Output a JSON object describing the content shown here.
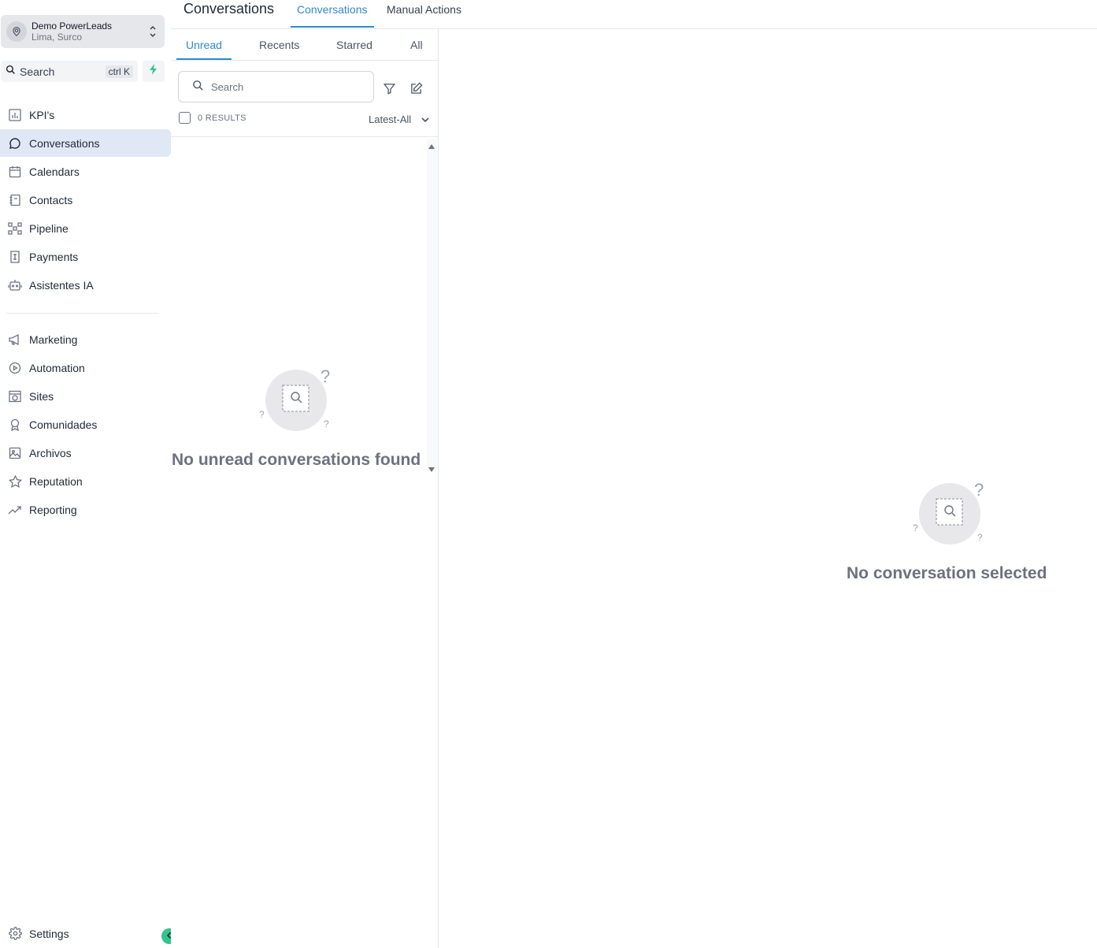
{
  "account": {
    "name": "Demo PowerLeads",
    "location": "Lima, Surco"
  },
  "search": {
    "label": "Search",
    "shortcut": "ctrl K"
  },
  "nav": {
    "primary": [
      {
        "label": "KPI's",
        "icon": "bar-chart-icon"
      },
      {
        "label": "Conversations",
        "icon": "chat-bubble-icon",
        "active": true
      },
      {
        "label": "Calendars",
        "icon": "calendar-icon"
      },
      {
        "label": "Contacts",
        "icon": "contact-book-icon"
      },
      {
        "label": "Pipeline",
        "icon": "pipeline-icon"
      },
      {
        "label": "Payments",
        "icon": "receipt-icon"
      },
      {
        "label": "Asistentes IA",
        "icon": "robot-icon"
      }
    ],
    "secondary": [
      {
        "label": "Marketing",
        "icon": "megaphone-icon"
      },
      {
        "label": "Automation",
        "icon": "play-circle-icon"
      },
      {
        "label": "Sites",
        "icon": "globe-window-icon"
      },
      {
        "label": "Comunidades",
        "icon": "award-icon"
      },
      {
        "label": "Archivos",
        "icon": "image-icon"
      },
      {
        "label": "Reputation",
        "icon": "star-icon"
      },
      {
        "label": "Reporting",
        "icon": "trend-up-icon"
      }
    ],
    "settings": {
      "label": "Settings",
      "icon": "gear-icon"
    }
  },
  "header": {
    "title": "Conversations",
    "tabs": [
      {
        "label": "Conversations",
        "active": true
      },
      {
        "label": "Manual Actions",
        "active": false
      }
    ]
  },
  "list": {
    "tabs": [
      {
        "label": "Unread",
        "active": true
      },
      {
        "label": "Recents"
      },
      {
        "label": "Starred"
      },
      {
        "label": "All"
      }
    ],
    "search_placeholder": "Search",
    "results": "0 RESULTS",
    "sort": "Latest-All",
    "empty_text": "No unread conversations found"
  },
  "main": {
    "empty_text": "No conversation selected"
  },
  "colors": {
    "accent": "#2e8bc9",
    "active_nav_bg": "#e0e7f5",
    "brand_green": "#34c38f",
    "muted_text": "#6b7280"
  }
}
